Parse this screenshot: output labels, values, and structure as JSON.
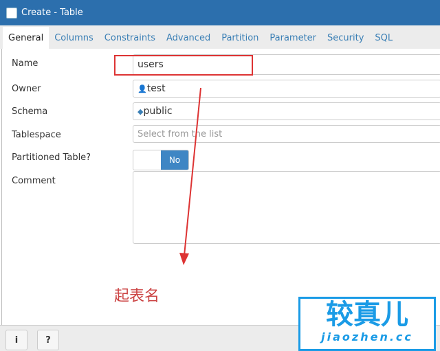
{
  "window": {
    "title": "Create - Table"
  },
  "tabs": [
    "General",
    "Columns",
    "Constraints",
    "Advanced",
    "Partition",
    "Parameter",
    "Security",
    "SQL"
  ],
  "form": {
    "name_label": "Name",
    "name_value": "users",
    "owner_label": "Owner",
    "owner_value": "test",
    "schema_label": "Schema",
    "schema_value": "public",
    "tablespace_label": "Tablespace",
    "tablespace_placeholder": "Select from the list",
    "partitioned_label": "Partitioned Table?",
    "partitioned_value": "No",
    "comment_label": "Comment"
  },
  "annotation": {
    "text": "起表名",
    "color": "#cc4444"
  },
  "footer": {
    "info": "i",
    "help": "?"
  },
  "watermark": {
    "cn": "较真儿",
    "url": "jiaozhen.cc"
  },
  "colors": {
    "titlebar": "#2c6fad",
    "accent": "#3f86c4"
  }
}
